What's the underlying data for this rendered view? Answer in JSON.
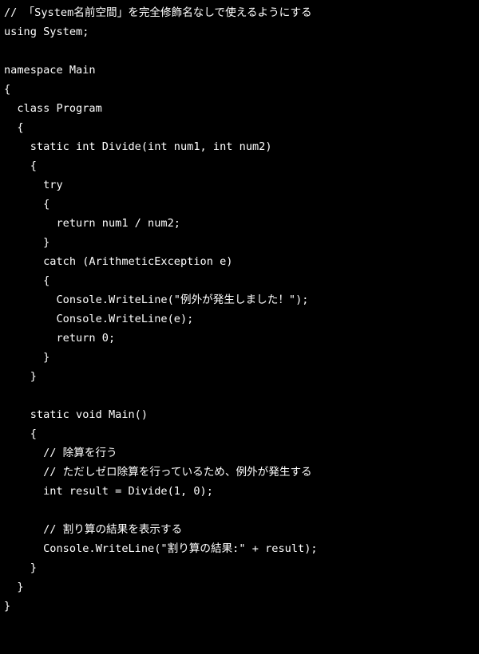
{
  "app": {
    "kind": "code-viewer",
    "language": "C#",
    "background_color": "#000000",
    "text_color": "#ffffff",
    "font_kind": "monospace",
    "indent_unit_spaces": 2,
    "line_height_px": 24,
    "has_line_numbers": false,
    "has_scrollbar": false,
    "has_titlebar": false,
    "has_toolbar": false,
    "has_syntax_highlighting": false
  },
  "code": {
    "total_lines": 34,
    "lines": [
      "// 「System名前空間」を完全修飾名なしで使えるようにする",
      "using System;",
      "",
      "namespace Main",
      "{",
      "  class Program",
      "  {",
      "    static int Divide(int num1, int num2)",
      "    {",
      "      try",
      "      {",
      "        return num1 / num2;",
      "      }",
      "      catch (ArithmeticException e)",
      "      {",
      "        Console.WriteLine(\"例外が発生しました！\");",
      "        Console.WriteLine(e);",
      "        return 0;",
      "      }",
      "    }",
      "",
      "    static void Main()",
      "    {",
      "      // 除算を行う",
      "      // ただしゼロ除算を行っているため、例外が発生する",
      "      int result = Divide(1, 0);",
      "",
      "      // 割り算の結果を表示する",
      "      Console.WriteLine(\"割り算の結果:\" + result);",
      "    }",
      "  }",
      "}",
      "",
      ""
    ]
  }
}
